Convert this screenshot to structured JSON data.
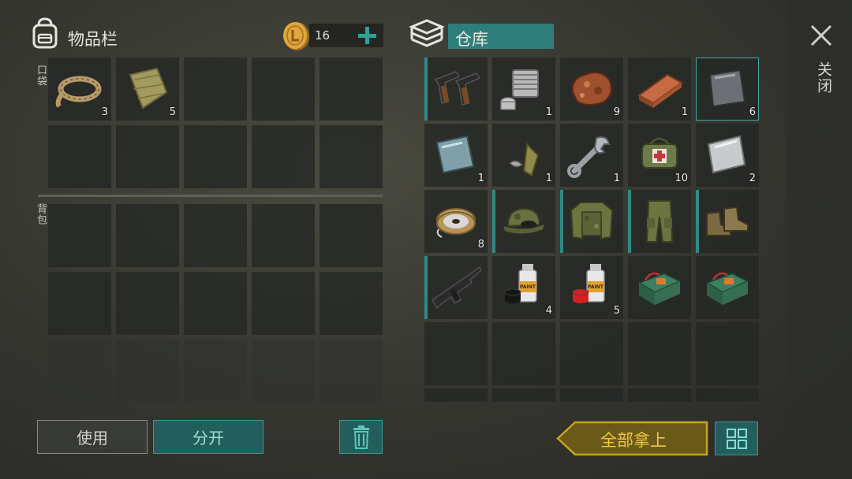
{
  "inventory": {
    "title": "物品栏",
    "coins": "16",
    "pocket_label": "口袋",
    "backpack_label": "背包",
    "pocket_items": [
      {
        "name": "rope",
        "icon": "rope-icon",
        "count": "3"
      },
      {
        "name": "cloth",
        "icon": "cloth-icon",
        "count": "5"
      }
    ]
  },
  "storage": {
    "title": "仓库",
    "close_label": "关闭",
    "items": [
      {
        "name": "pistols",
        "icon": "pistols-icon",
        "count": "",
        "bar": true
      },
      {
        "name": "engine-cylinder",
        "icon": "engine-cylinder-icon",
        "count": "1"
      },
      {
        "name": "copper-ore",
        "icon": "copper-ore-icon",
        "count": "9"
      },
      {
        "name": "copper-ingot",
        "icon": "copper-ingot-icon",
        "count": "1"
      },
      {
        "name": "iron-plate",
        "icon": "iron-plate-icon",
        "count": "6",
        "selected": true
      },
      {
        "name": "glass-plate",
        "icon": "glass-plate-icon",
        "count": "1"
      },
      {
        "name": "weapon-parts",
        "icon": "weapon-parts-icon",
        "count": "1"
      },
      {
        "name": "wrench",
        "icon": "wrench-icon",
        "count": "1"
      },
      {
        "name": "medkit-bag",
        "icon": "medkit-bag-icon",
        "count": "10"
      },
      {
        "name": "steel-plate",
        "icon": "steel-plate-icon",
        "count": "2"
      },
      {
        "name": "wire-spool",
        "icon": "wire-spool-icon",
        "count": "8"
      },
      {
        "name": "camo-cap",
        "icon": "camo-cap-icon",
        "count": "",
        "bar": true
      },
      {
        "name": "camo-jacket",
        "icon": "camo-jacket-icon",
        "count": "",
        "bar": true
      },
      {
        "name": "camo-pants",
        "icon": "camo-pants-icon",
        "count": "",
        "bar": true
      },
      {
        "name": "boots",
        "icon": "boots-icon",
        "count": "",
        "bar": true
      },
      {
        "name": "assault-rifle",
        "icon": "assault-rifle-icon",
        "count": "",
        "bar": true
      },
      {
        "name": "black-spray-paint",
        "icon": "spray-paint-icon",
        "count": "4"
      },
      {
        "name": "red-spray-paint",
        "icon": "spray-paint-icon",
        "count": "5"
      },
      {
        "name": "explosive-box",
        "icon": "explosive-box-icon",
        "count": ""
      },
      {
        "name": "explosive-box",
        "icon": "explosive-box-icon",
        "count": ""
      }
    ],
    "spray_label": "PAINT"
  },
  "buttons": {
    "use": "使用",
    "split": "分开",
    "take_all": "全部拿上"
  },
  "colors": {
    "accent_teal": "#2f8a86",
    "take_all_gold": "#c9a21e",
    "take_all_text": "#f2c83c"
  }
}
